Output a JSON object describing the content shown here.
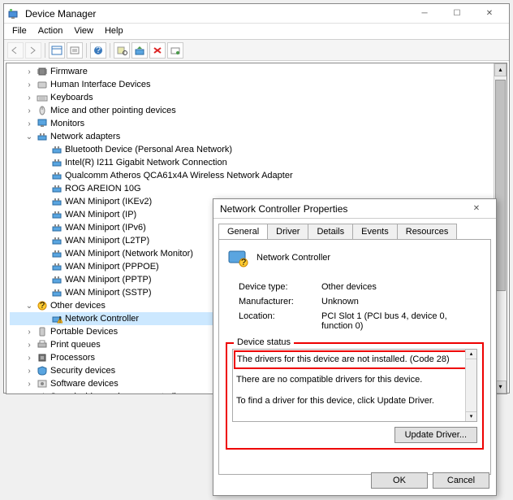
{
  "mainWindow": {
    "title": "Device Manager",
    "menu": [
      "File",
      "Action",
      "View",
      "Help"
    ],
    "tree": [
      {
        "d": 1,
        "e": ">",
        "i": "chip",
        "t": "Firmware"
      },
      {
        "d": 1,
        "e": ">",
        "i": "hid",
        "t": "Human Interface Devices"
      },
      {
        "d": 1,
        "e": ">",
        "i": "kb",
        "t": "Keyboards"
      },
      {
        "d": 1,
        "e": ">",
        "i": "mouse",
        "t": "Mice and other pointing devices"
      },
      {
        "d": 1,
        "e": ">",
        "i": "mon",
        "t": "Monitors"
      },
      {
        "d": 1,
        "e": "v",
        "i": "net",
        "t": "Network adapters"
      },
      {
        "d": 2,
        "e": "",
        "i": "net",
        "t": "Bluetooth Device (Personal Area Network)"
      },
      {
        "d": 2,
        "e": "",
        "i": "net",
        "t": "Intel(R) I211 Gigabit Network Connection"
      },
      {
        "d": 2,
        "e": "",
        "i": "net",
        "t": "Qualcomm Atheros QCA61x4A Wireless Network Adapter"
      },
      {
        "d": 2,
        "e": "",
        "i": "net",
        "t": "ROG AREION 10G"
      },
      {
        "d": 2,
        "e": "",
        "i": "net",
        "t": "WAN Miniport (IKEv2)"
      },
      {
        "d": 2,
        "e": "",
        "i": "net",
        "t": "WAN Miniport (IP)"
      },
      {
        "d": 2,
        "e": "",
        "i": "net",
        "t": "WAN Miniport (IPv6)"
      },
      {
        "d": 2,
        "e": "",
        "i": "net",
        "t": "WAN Miniport (L2TP)"
      },
      {
        "d": 2,
        "e": "",
        "i": "net",
        "t": "WAN Miniport (Network Monitor)"
      },
      {
        "d": 2,
        "e": "",
        "i": "net",
        "t": "WAN Miniport (PPPOE)"
      },
      {
        "d": 2,
        "e": "",
        "i": "net",
        "t": "WAN Miniport (PPTP)"
      },
      {
        "d": 2,
        "e": "",
        "i": "net",
        "t": "WAN Miniport (SSTP)"
      },
      {
        "d": 1,
        "e": "v",
        "i": "unk",
        "t": "Other devices"
      },
      {
        "d": 2,
        "e": "",
        "i": "warn",
        "t": "Network Controller",
        "sel": true
      },
      {
        "d": 1,
        "e": ">",
        "i": "port",
        "t": "Portable Devices"
      },
      {
        "d": 1,
        "e": ">",
        "i": "print",
        "t": "Print queues"
      },
      {
        "d": 1,
        "e": ">",
        "i": "cpu",
        "t": "Processors"
      },
      {
        "d": 1,
        "e": ">",
        "i": "sec",
        "t": "Security devices"
      },
      {
        "d": 1,
        "e": ">",
        "i": "soft",
        "t": "Software devices"
      },
      {
        "d": 1,
        "e": ">",
        "i": "snd",
        "t": "Sound, video and game controllers"
      }
    ]
  },
  "dialog": {
    "title": "Network Controller Properties",
    "tabs": [
      "General",
      "Driver",
      "Details",
      "Events",
      "Resources"
    ],
    "activeTab": 0,
    "deviceName": "Network Controller",
    "rows": [
      {
        "label": "Device type:",
        "value": "Other devices"
      },
      {
        "label": "Manufacturer:",
        "value": "Unknown"
      },
      {
        "label": "Location:",
        "value": "PCI Slot 1 (PCI bus 4, device 0, function 0)"
      }
    ],
    "statusLabel": "Device status",
    "statusLine1": "The drivers for this device are not installed. (Code 28)",
    "statusLine2": "There are no compatible drivers for this device.",
    "statusLine3": "To find a driver for this device, click Update Driver.",
    "updateBtn": "Update Driver...",
    "ok": "OK",
    "cancel": "Cancel"
  }
}
